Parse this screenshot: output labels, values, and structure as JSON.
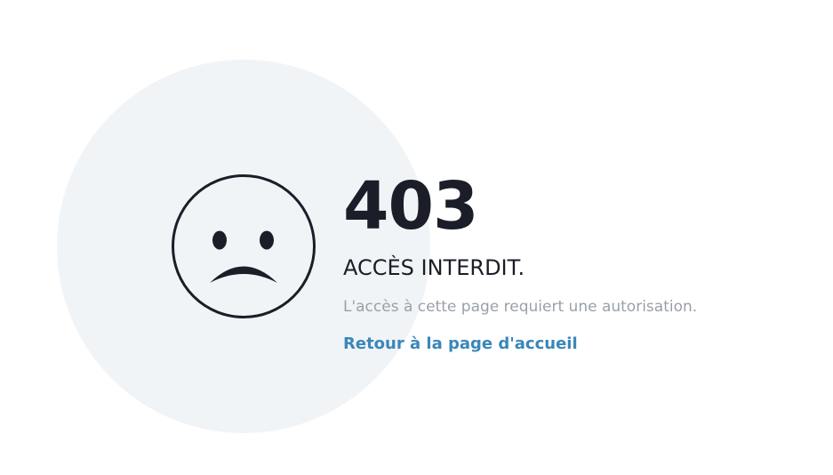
{
  "error": {
    "code": "403",
    "title": "ACCÈS INTERDIT.",
    "description": "L'accès à cette page requiert une autorisation.",
    "home_link_label": "Retour à la page d'accueil"
  },
  "icons": {
    "face": "sad-face-icon"
  },
  "colors": {
    "circle_background": "#f1f4f7",
    "text_dark": "#1b1d28",
    "text_muted": "#9aa0a8",
    "link": "#3a87b8"
  }
}
